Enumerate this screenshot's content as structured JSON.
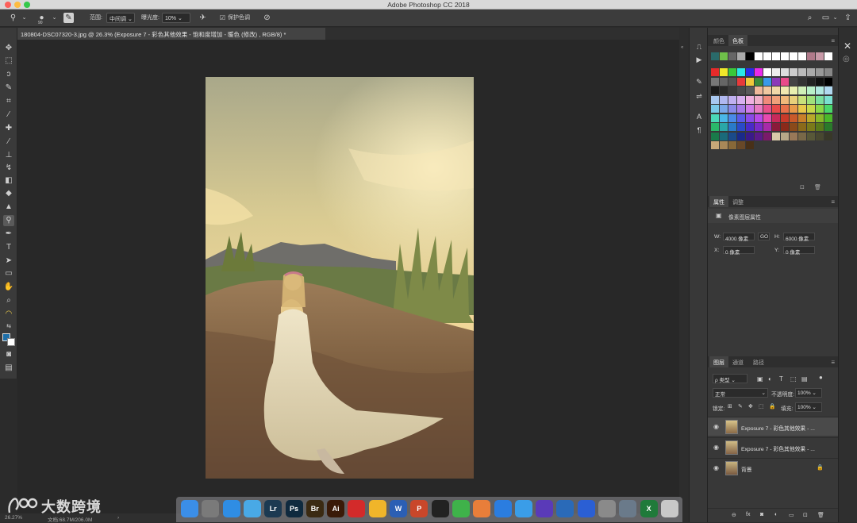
{
  "window": {
    "title": "Adobe Photoshop CC 2018",
    "traffic_colors": [
      "#fc605b",
      "#fdbc40",
      "#34c84a"
    ]
  },
  "options_bar": {
    "brush_size": "90",
    "range_label": "范围:",
    "range_value": "中间调",
    "exposure_label": "曝光度:",
    "exposure_value": "10%",
    "protect_tones_label": "保护色调"
  },
  "document": {
    "tab_title": "180804-DSC07320-3.jpg @ 26.3% (Exposure 7 - 彩色其他效果 - 饱和度增加 - 暖色 (修改) , RGB/8) *"
  },
  "status": {
    "zoom": "26.27%",
    "doc_size": "文档:68.7M/206.0M"
  },
  "swatches_panel": {
    "tabs": [
      "颜色",
      "色板"
    ],
    "active_tab": 1
  },
  "properties_panel": {
    "tabs": [
      "属性",
      "调整"
    ],
    "active_tab": 0,
    "subtitle": "像素图层属性",
    "w_label": "W:",
    "w_value": "4000 像素",
    "link_label": "GO",
    "h_label": "H:",
    "h_value": "6000 像素",
    "x_label": "X:",
    "x_value": "0 像素",
    "y_label": "Y:",
    "y_value": "0 像素"
  },
  "layers_panel": {
    "tabs": [
      "图层",
      "通道",
      "路径"
    ],
    "active_tab": 0,
    "filter_label": "ρ 类型",
    "blend_mode": "正常",
    "opacity_label": "不透明度:",
    "opacity_value": "100%",
    "lock_label": "锁定:",
    "fill_label": "填充:",
    "fill_value": "100%",
    "layers": [
      {
        "name": "Exposure 7 - 彩色其他效果 - ...",
        "selected": true,
        "locked": false
      },
      {
        "name": "Exposure 7 - 彩色其他效果 - ...",
        "selected": false,
        "locked": false
      },
      {
        "name": "背景",
        "selected": false,
        "locked": true
      }
    ]
  },
  "dock": {
    "apps": [
      {
        "label": "",
        "color": "#3b8ee8"
      },
      {
        "label": "",
        "color": "#7a7a7a"
      },
      {
        "label": "",
        "color": "#2f8de4"
      },
      {
        "label": "",
        "color": "#49a9e6"
      },
      {
        "label": "Lr",
        "color": "#1c3a52"
      },
      {
        "label": "Ps",
        "color": "#0f2a3f"
      },
      {
        "label": "Br",
        "color": "#3b2a12"
      },
      {
        "label": "Ai",
        "color": "#3a1a08"
      },
      {
        "label": "",
        "color": "#d32a2a"
      },
      {
        "label": "",
        "color": "#f0b52a"
      },
      {
        "label": "W",
        "color": "#2b5fb4"
      },
      {
        "label": "P",
        "color": "#c9472a"
      },
      {
        "label": "",
        "color": "#222222"
      },
      {
        "label": "",
        "color": "#3fb24a"
      },
      {
        "label": "",
        "color": "#e87e3a"
      },
      {
        "label": "",
        "color": "#2b7de0"
      },
      {
        "label": "",
        "color": "#3a9de8"
      },
      {
        "label": "",
        "color": "#5a3ab8"
      },
      {
        "label": "",
        "color": "#2a6ab8"
      },
      {
        "label": "",
        "color": "#2b5fd4"
      },
      {
        "label": "",
        "color": "#8a8a8a"
      },
      {
        "label": "",
        "color": "#6a7a8a"
      },
      {
        "label": "X",
        "color": "#1f7a3a"
      },
      {
        "label": "",
        "color": "#c8c8c8"
      }
    ]
  },
  "watermark": {
    "text": "大数跨境"
  }
}
